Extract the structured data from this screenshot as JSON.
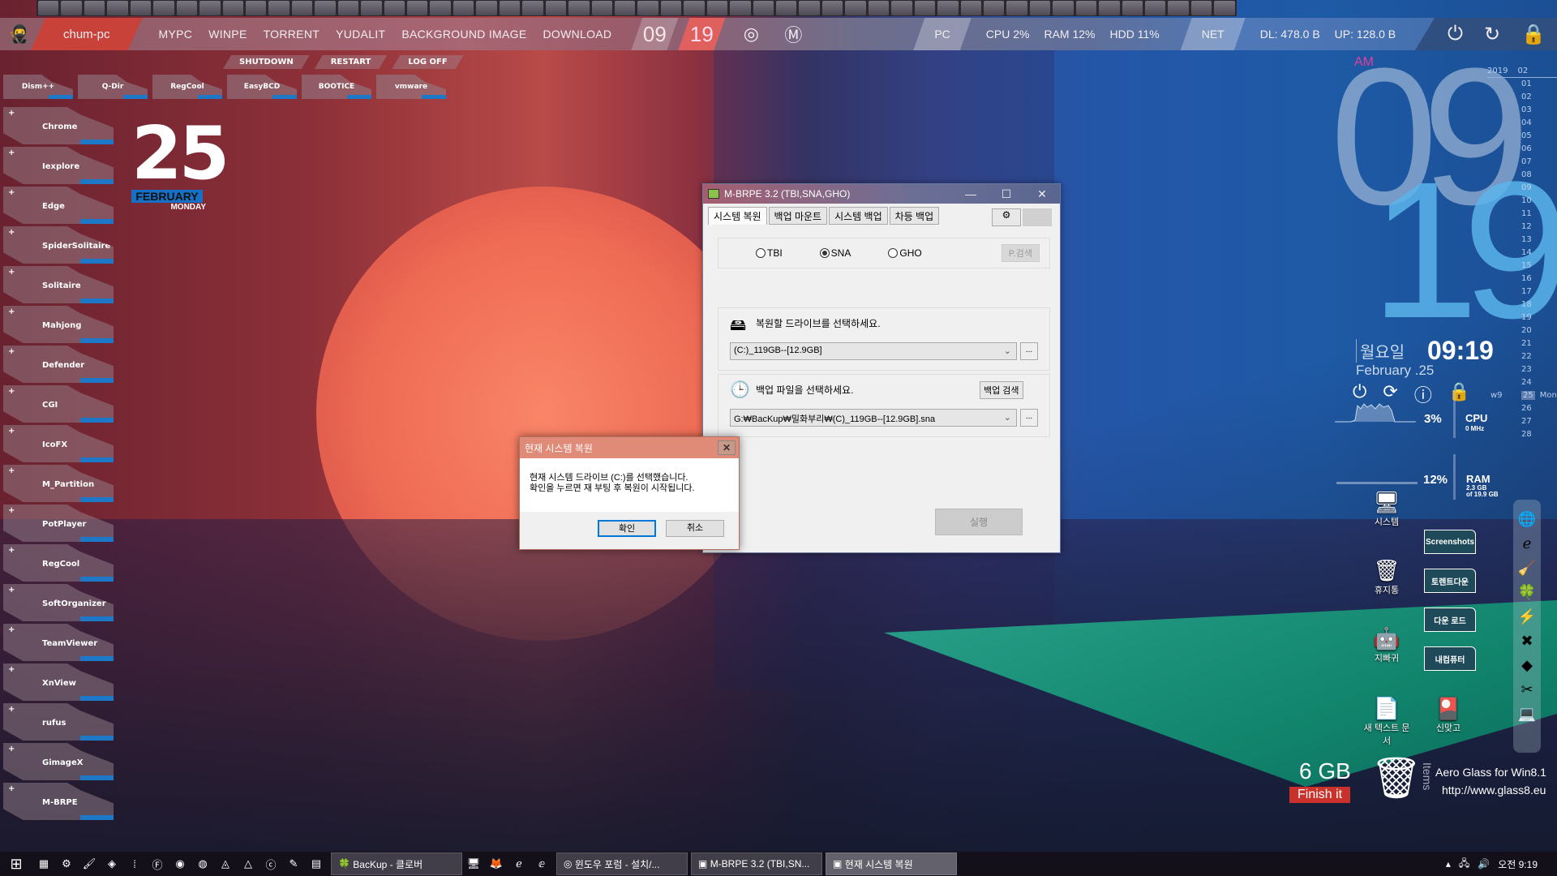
{
  "topbar": {
    "hostname": "chum-pc",
    "nav": [
      "MYPC",
      "WINPE",
      "TORRENT",
      "YUDALIT",
      "BACKGROUND IMAGE",
      "DOWNLOAD"
    ],
    "hour": "09",
    "minute": "19",
    "pc_label": "PC",
    "cpu": "CPU 2%",
    "ram": "RAM 12%",
    "hdd": "HDD 11%",
    "net_label": "NET",
    "dl": "DL: 478.0 B",
    "up": "UP: 128.0 B"
  },
  "subnav": [
    "SHUTDOWN",
    "RESTART",
    "LOG OFF"
  ],
  "apps_row": [
    "Dism++",
    "Q-Dir",
    "RegCool",
    "EasyBCD",
    "BOOTICE",
    "vmware"
  ],
  "launcher": [
    "Chrome",
    "Iexplore",
    "Edge",
    "SpiderSolitaire",
    "Solitaire",
    "Mahjong",
    "Defender",
    "CGI",
    "IcoFX",
    "M_Partition",
    "PotPlayer",
    "RegCool",
    "SoftOrganizer",
    "TeamViewer",
    "XnView",
    "rufus",
    "GimageX",
    "M-BRPE"
  ],
  "date_widget": {
    "day": "25",
    "month": "FEBRUARY",
    "weekday": "MONDAY"
  },
  "big_clock": {
    "ampm": "AM",
    "hour": "09",
    "minute": "19"
  },
  "calendar": {
    "year": "2019",
    "month": "02",
    "week": "w9",
    "today": "25",
    "today_label": "Mon",
    "days": [
      "01",
      "02",
      "03",
      "04",
      "05",
      "06",
      "07",
      "08",
      "09",
      "10",
      "11",
      "12",
      "13",
      "14",
      "15",
      "16",
      "17",
      "18",
      "19",
      "20",
      "21",
      "22",
      "23",
      "24",
      "25",
      "26",
      "27",
      "28"
    ]
  },
  "korean_clock": {
    "weekday": "월요일",
    "date": "February .25",
    "time": "09:19"
  },
  "system": {
    "cpu_pct": "3%",
    "cpu_label": "CPU",
    "cpu_mhz": "0 MHz",
    "ram_pct": "12%",
    "ram_label": "RAM",
    "ram_used": "2.3 GB",
    "ram_total": "of 19.9 GB"
  },
  "desktop_icons": [
    {
      "label": "시스템"
    },
    {
      "label": "휴지통"
    },
    {
      "label": "지빠귀"
    },
    {
      "label": "새 텍스트 문서"
    },
    {
      "label": "신맞고"
    }
  ],
  "folders": [
    "Screenshots",
    "토렌트다운",
    "다운 로드",
    "내컴퓨터"
  ],
  "recycle": {
    "size": "6 GB",
    "action": "Finish it",
    "items": "Items"
  },
  "aero": {
    "line1": "Aero Glass for Win8.1",
    "line2": "http://www.glass8.eu"
  },
  "mbrpe": {
    "title": "M-BRPE 3.2 (TBI,SNA,GHO)",
    "tabs": [
      "시스템 복원",
      "백업 마운트",
      "시스템 백업",
      "차등 백업"
    ],
    "radios": [
      {
        "label": "TBI",
        "checked": false
      },
      {
        "label": "SNA",
        "checked": true
      },
      {
        "label": "GHO",
        "checked": false
      }
    ],
    "p_search": "P.검색",
    "drive_prompt": "복원할 드라이브를 선택하세요.",
    "drive_value": "(C:)_119GB--[12.9GB]",
    "backup_prompt": "백업 파일을 선택하세요.",
    "backup_search": "백업 검색",
    "backup_value": "G:₩BacKup₩밀화부리₩(C)_119GB--[12.9GB].sna",
    "browse": "...",
    "run": "실행"
  },
  "confirm": {
    "title": "현재 시스템 복원",
    "line1": "현재 시스템 드라이브 (C:)를 선택했습니다.",
    "line2": "확인을 누르면 재 부팅 후 복원이 시작됩니다.",
    "ok": "확인",
    "cancel": "취소"
  },
  "taskbar": {
    "tasks": [
      "BacKup - 클로버",
      "윈도우 포럼 - 설치/...",
      "M-BRPE 3.2 (TBI,SN...",
      "현재 시스템 복원"
    ],
    "clock": "오전 9:19"
  }
}
